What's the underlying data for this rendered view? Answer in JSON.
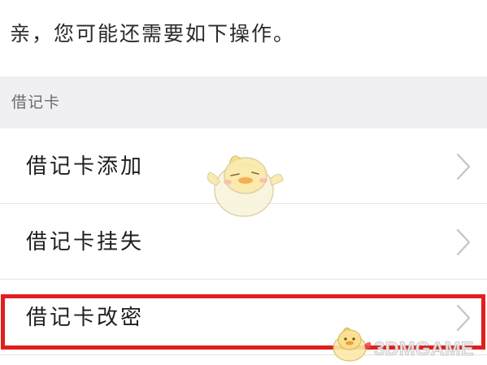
{
  "prompt": {
    "text": "亲，您可能还需要如下操作。"
  },
  "section": {
    "title": "借记卡"
  },
  "menu": {
    "items": [
      {
        "label": "借记卡添加",
        "icon": "chevron-right-icon"
      },
      {
        "label": "借记卡挂失",
        "icon": "chevron-right-icon"
      },
      {
        "label": "借记卡改密",
        "icon": "chevron-right-icon",
        "highlighted": true
      }
    ]
  },
  "watermark": {
    "text": "3DMGAME"
  },
  "colors": {
    "section_background": "#f0eff4",
    "highlight_border": "#e0201d",
    "chevron": "#c4c4c4",
    "divider": "#e3e3e3"
  }
}
